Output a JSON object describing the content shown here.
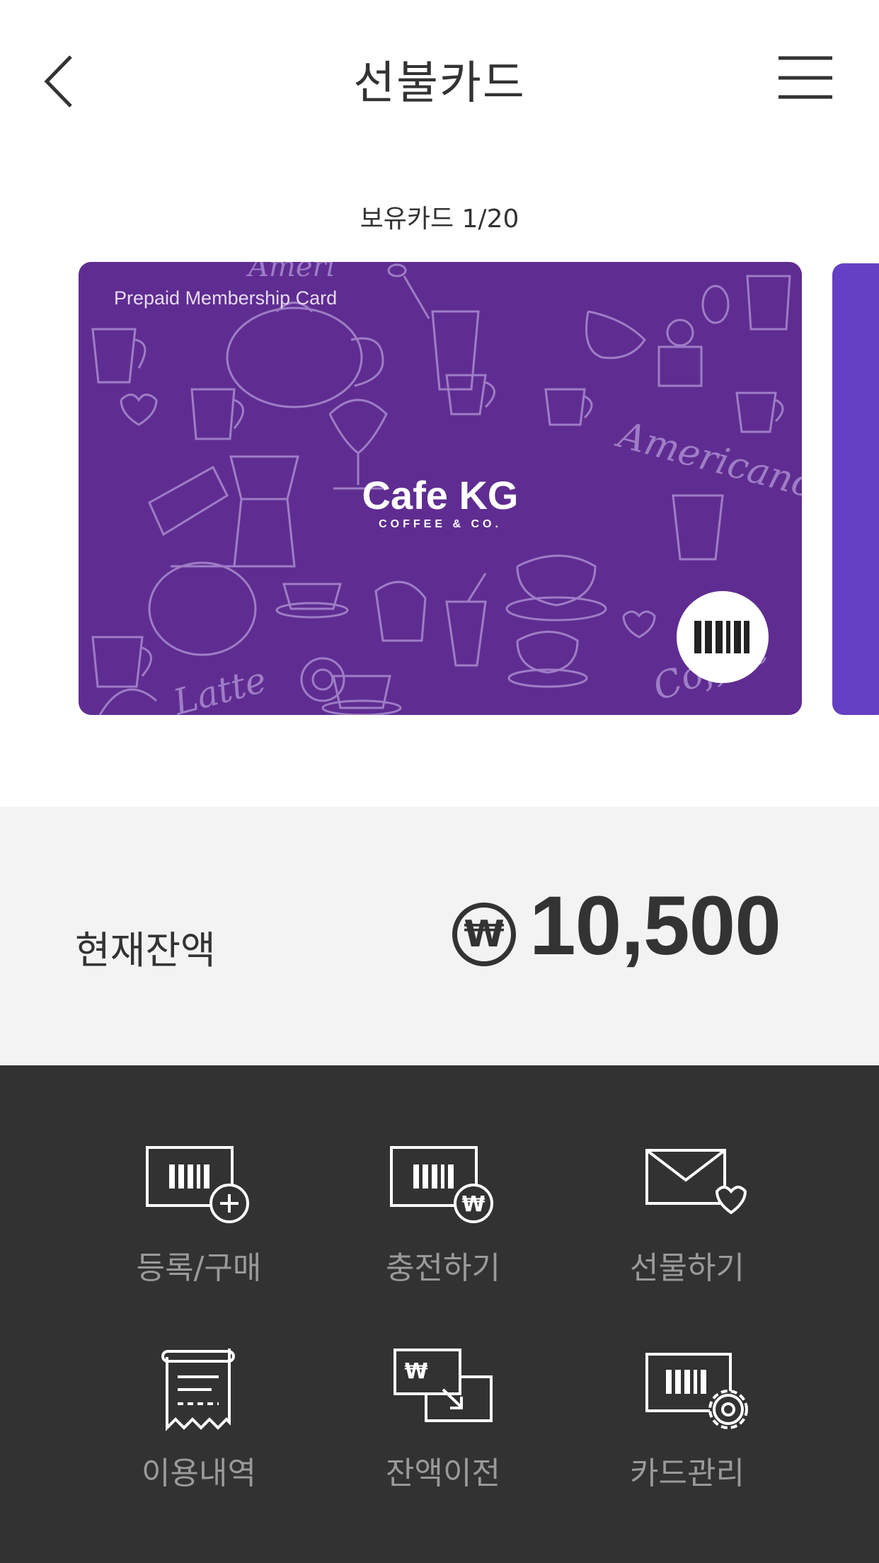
{
  "header": {
    "title": "선불카드",
    "back_icon": "chevron-left-icon",
    "menu_icon": "hamburger-menu-icon"
  },
  "card_count": "보유카드 1/20",
  "card": {
    "label": "Prepaid Membership Card",
    "brand_name": "Cafe KG",
    "brand_sub": "COFFEE & CO.",
    "color": "#5f2d91",
    "barcode_icon": "barcode-icon"
  },
  "next_card_color": "#6440c4",
  "balance": {
    "label": "현재잔액",
    "currency_symbol": "₩",
    "amount": "10,500"
  },
  "menu": {
    "items": [
      {
        "label": "등록/구매",
        "icon": "card-add-icon"
      },
      {
        "label": "충전하기",
        "icon": "card-charge-icon"
      },
      {
        "label": "선물하기",
        "icon": "gift-envelope-icon"
      },
      {
        "label": "이용내역",
        "icon": "receipt-icon"
      },
      {
        "label": "잔액이전",
        "icon": "balance-transfer-icon"
      },
      {
        "label": "카드관리",
        "icon": "card-settings-icon"
      }
    ]
  }
}
